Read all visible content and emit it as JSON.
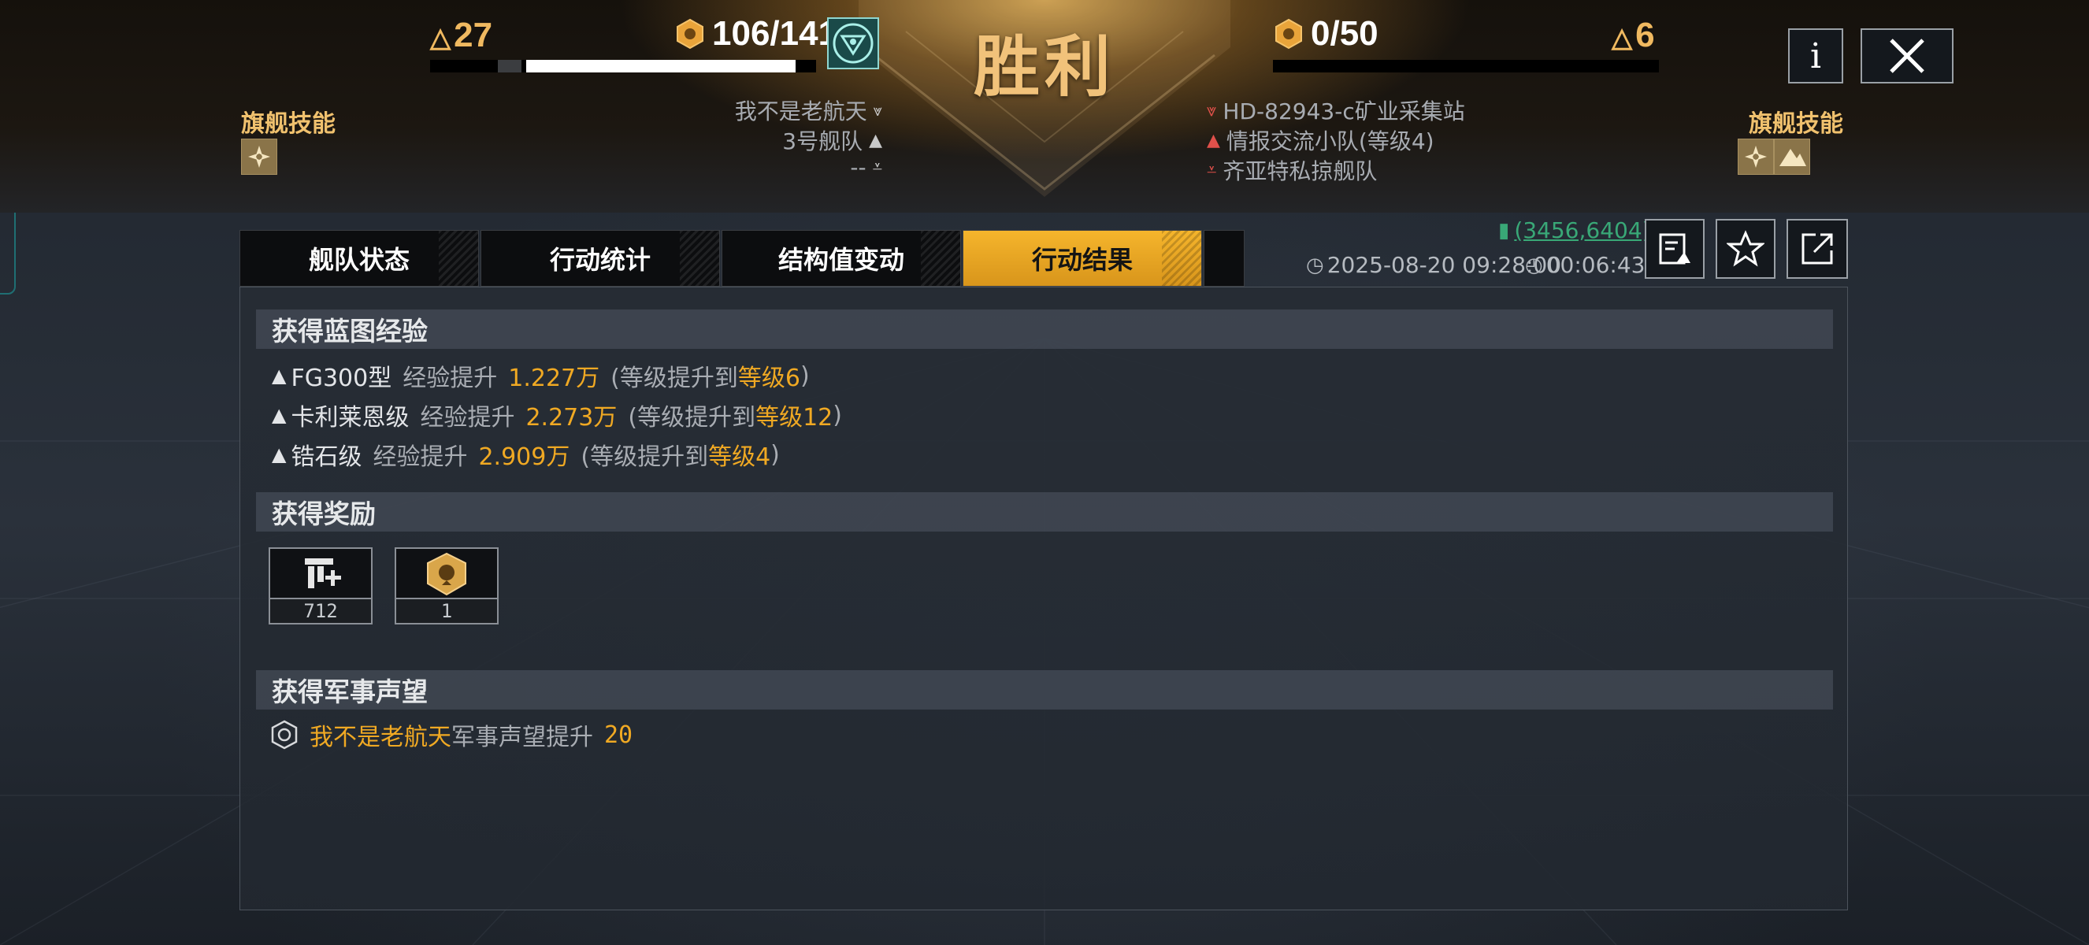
{
  "banner": {
    "result_title": "胜利",
    "left": {
      "delta": "27",
      "score": "106/141",
      "bar_progress": 0.93,
      "flagship_skill_label": "旗舰技能",
      "players": [
        {
          "name": "我不是老航天",
          "icon": "double-chevron-down-icon"
        },
        {
          "name": "3号舰队",
          "icon": "chevron-up-icon"
        },
        {
          "name": "--",
          "icon": "rank-chevron-icon"
        }
      ]
    },
    "right": {
      "delta": "6",
      "score": "0/50",
      "bar_progress": 0,
      "flagship_skill_label": "旗舰技能",
      "targets": [
        {
          "name": "HD-82943-c矿业采集站",
          "icon": "red-chevron-down-icon"
        },
        {
          "name": "情报交流小队(等级4)",
          "icon": "red-chevron-up-icon"
        },
        {
          "name": "齐亚特私掠舰队",
          "icon": "red-rank-icon"
        }
      ]
    },
    "buttons": {
      "info_label": "i",
      "close_icon": "close-icon"
    }
  },
  "tabs": [
    {
      "label": "舰队状态",
      "active": false
    },
    {
      "label": "行动统计",
      "active": false
    },
    {
      "label": "结构值变动",
      "active": false
    },
    {
      "label": "行动结果",
      "active": true
    }
  ],
  "meta": {
    "coordinates": "(3456,6404)",
    "datetime": "2025-08-20 09:28:00",
    "duration": "00:06:43"
  },
  "toolbar": [
    "edit-report-icon",
    "star-icon",
    "share-icon"
  ],
  "sections": {
    "blueprint_exp": {
      "title": "获得蓝图经验",
      "rows": [
        {
          "ship": "FG300型",
          "label": "经验提升",
          "amount": "1.227万",
          "paren_open": "(等级提升到 ",
          "level": "等级6",
          "paren_close": ")"
        },
        {
          "ship": "卡利莱恩级",
          "label": "经验提升",
          "amount": "2.273万",
          "paren_open": "(等级提升到 ",
          "level": "等级12",
          "paren_close": ")"
        },
        {
          "ship": "锆石级",
          "label": "经验提升",
          "amount": "2.909万",
          "paren_open": "(等级提升到 ",
          "level": "等级4",
          "paren_close": ")"
        }
      ]
    },
    "rewards": {
      "title": "获得奖励",
      "items": [
        {
          "icon": "resource-plus-icon",
          "count": "712"
        },
        {
          "icon": "lion-badge-icon",
          "count": "1"
        }
      ]
    },
    "reputation": {
      "title": "获得军事声望",
      "player": "我不是老航天",
      "text": "军事声望提升",
      "amount": "20"
    }
  },
  "colors": {
    "accent_gold": "#f0a923",
    "tab_active": "#f5b52c",
    "coords_green": "#39a877",
    "enemy_red": "#e0504a"
  }
}
